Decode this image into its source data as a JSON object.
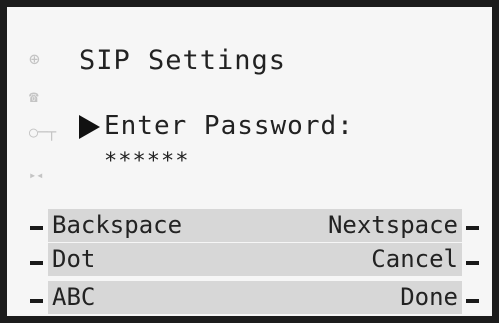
{
  "screen": {
    "title": "SIP Settings",
    "prompt": "Enter Password:",
    "password_value": "******"
  },
  "side_icons": [
    "globe-icon",
    "phone-icon",
    "key-icon",
    "split-icon"
  ],
  "softkeys": {
    "row1": {
      "left": "Backspace",
      "right": "Nextspace"
    },
    "row2": {
      "left": "Dot",
      "right": "Cancel"
    },
    "row3": {
      "left": "ABC",
      "right": "Done"
    }
  }
}
